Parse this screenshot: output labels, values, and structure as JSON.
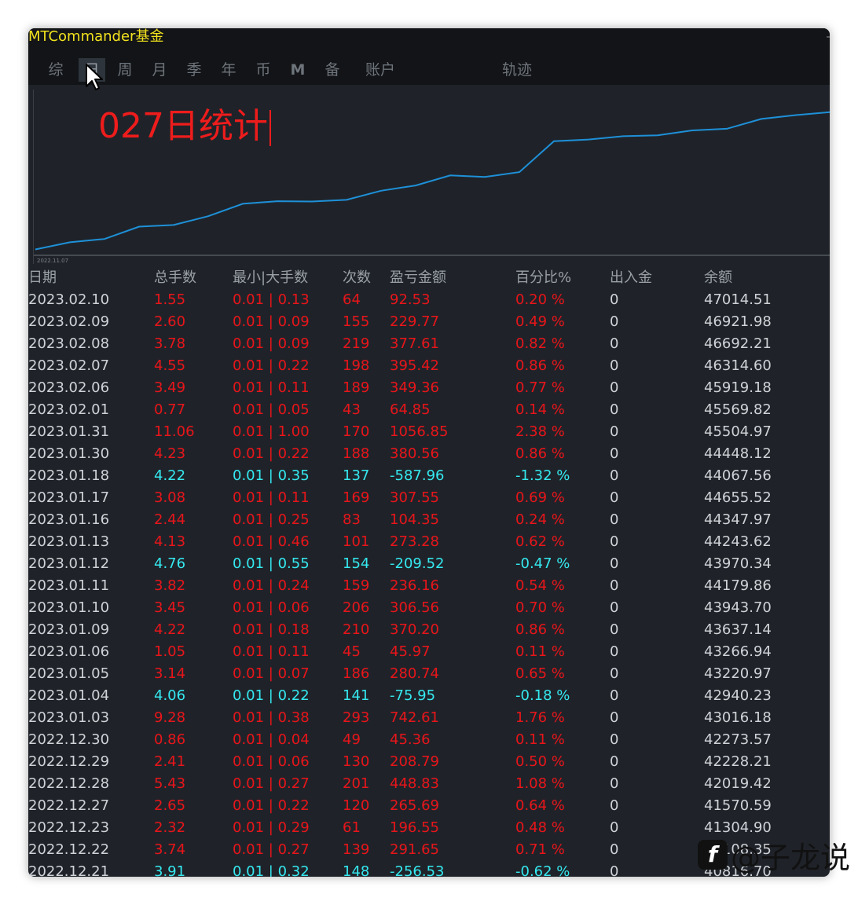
{
  "window": {
    "title": "MTCommander基金"
  },
  "tabs": [
    {
      "label": "综"
    },
    {
      "label": "日"
    },
    {
      "label": "周"
    },
    {
      "label": "月"
    },
    {
      "label": "季"
    },
    {
      "label": "年"
    },
    {
      "label": "币"
    },
    {
      "label": "M"
    },
    {
      "label": "备"
    },
    {
      "label": "账户"
    },
    {
      "label": "轨迹"
    }
  ],
  "active_tab": "日",
  "chart": {
    "title": "027日统计",
    "x_start_label": "2022.11.07",
    "line_color": "#1e90d8",
    "chart_data": {
      "type": "line",
      "title": "027日统计",
      "xlabel": "",
      "ylabel": "",
      "x": [
        "2022.11.07"
      ],
      "series": [
        {
          "values": [
            41580,
            41800,
            41900,
            42280,
            42330,
            42600,
            42980,
            43060,
            43050,
            43100,
            43380,
            43540,
            43850,
            43800,
            43950,
            44900,
            44950,
            45050,
            45080,
            45230,
            45280,
            45580,
            45700,
            45790
          ]
        }
      ]
    }
  },
  "table": {
    "headers": [
      "日期",
      "总手数",
      "最小|大手数",
      "次数",
      "盈亏金额",
      "百分比%",
      "出入金",
      "余额"
    ],
    "rows": [
      {
        "date": "2023.02.10",
        "lots": "1.55",
        "minmax": "0.01 | 0.13",
        "count": "64",
        "pnl": "92.53",
        "pct": "0.20 %",
        "inout": "0",
        "balance": "47014.51",
        "sign": "pos"
      },
      {
        "date": "2023.02.09",
        "lots": "2.60",
        "minmax": "0.01 | 0.09",
        "count": "155",
        "pnl": "229.77",
        "pct": "0.49 %",
        "inout": "0",
        "balance": "46921.98",
        "sign": "pos"
      },
      {
        "date": "2023.02.08",
        "lots": "3.78",
        "minmax": "0.01 | 0.09",
        "count": "219",
        "pnl": "377.61",
        "pct": "0.82 %",
        "inout": "0",
        "balance": "46692.21",
        "sign": "pos"
      },
      {
        "date": "2023.02.07",
        "lots": "4.55",
        "minmax": "0.01 | 0.22",
        "count": "198",
        "pnl": "395.42",
        "pct": "0.86 %",
        "inout": "0",
        "balance": "46314.60",
        "sign": "pos"
      },
      {
        "date": "2023.02.06",
        "lots": "3.49",
        "minmax": "0.01 | 0.11",
        "count": "189",
        "pnl": "349.36",
        "pct": "0.77 %",
        "inout": "0",
        "balance": "45919.18",
        "sign": "pos"
      },
      {
        "date": "2023.02.01",
        "lots": "0.77",
        "minmax": "0.01 | 0.05",
        "count": "43",
        "pnl": "64.85",
        "pct": "0.14 %",
        "inout": "0",
        "balance": "45569.82",
        "sign": "pos"
      },
      {
        "date": "2023.01.31",
        "lots": "11.06",
        "minmax": "0.01 | 1.00",
        "count": "170",
        "pnl": "1056.85",
        "pct": "2.38 %",
        "inout": "0",
        "balance": "45504.97",
        "sign": "pos"
      },
      {
        "date": "2023.01.30",
        "lots": "4.23",
        "minmax": "0.01 | 0.22",
        "count": "188",
        "pnl": "380.56",
        "pct": "0.86 %",
        "inout": "0",
        "balance": "44448.12",
        "sign": "pos"
      },
      {
        "date": "2023.01.18",
        "lots": "4.22",
        "minmax": "0.01 | 0.35",
        "count": "137",
        "pnl": "-587.96",
        "pct": "-1.32 %",
        "inout": "0",
        "balance": "44067.56",
        "sign": "neg"
      },
      {
        "date": "2023.01.17",
        "lots": "3.08",
        "minmax": "0.01 | 0.11",
        "count": "169",
        "pnl": "307.55",
        "pct": "0.69 %",
        "inout": "0",
        "balance": "44655.52",
        "sign": "pos"
      },
      {
        "date": "2023.01.16",
        "lots": "2.44",
        "minmax": "0.01 | 0.25",
        "count": "83",
        "pnl": "104.35",
        "pct": "0.24 %",
        "inout": "0",
        "balance": "44347.97",
        "sign": "pos"
      },
      {
        "date": "2023.01.13",
        "lots": "4.13",
        "minmax": "0.01 | 0.46",
        "count": "101",
        "pnl": "273.28",
        "pct": "0.62 %",
        "inout": "0",
        "balance": "44243.62",
        "sign": "pos"
      },
      {
        "date": "2023.01.12",
        "lots": "4.76",
        "minmax": "0.01 | 0.55",
        "count": "154",
        "pnl": "-209.52",
        "pct": "-0.47 %",
        "inout": "0",
        "balance": "43970.34",
        "sign": "neg"
      },
      {
        "date": "2023.01.11",
        "lots": "3.82",
        "minmax": "0.01 | 0.24",
        "count": "159",
        "pnl": "236.16",
        "pct": "0.54 %",
        "inout": "0",
        "balance": "44179.86",
        "sign": "pos"
      },
      {
        "date": "2023.01.10",
        "lots": "3.45",
        "minmax": "0.01 | 0.06",
        "count": "206",
        "pnl": "306.56",
        "pct": "0.70 %",
        "inout": "0",
        "balance": "43943.70",
        "sign": "pos"
      },
      {
        "date": "2023.01.09",
        "lots": "4.22",
        "minmax": "0.01 | 0.18",
        "count": "210",
        "pnl": "370.20",
        "pct": "0.86 %",
        "inout": "0",
        "balance": "43637.14",
        "sign": "pos"
      },
      {
        "date": "2023.01.06",
        "lots": "1.05",
        "minmax": "0.01 | 0.11",
        "count": "45",
        "pnl": "45.97",
        "pct": "0.11 %",
        "inout": "0",
        "balance": "43266.94",
        "sign": "pos"
      },
      {
        "date": "2023.01.05",
        "lots": "3.14",
        "minmax": "0.01 | 0.07",
        "count": "186",
        "pnl": "280.74",
        "pct": "0.65 %",
        "inout": "0",
        "balance": "43220.97",
        "sign": "pos"
      },
      {
        "date": "2023.01.04",
        "lots": "4.06",
        "minmax": "0.01 | 0.22",
        "count": "141",
        "pnl": "-75.95",
        "pct": "-0.18 %",
        "inout": "0",
        "balance": "42940.23",
        "sign": "neg"
      },
      {
        "date": "2023.01.03",
        "lots": "9.28",
        "minmax": "0.01 | 0.38",
        "count": "293",
        "pnl": "742.61",
        "pct": "1.76 %",
        "inout": "0",
        "balance": "43016.18",
        "sign": "pos"
      },
      {
        "date": "2022.12.30",
        "lots": "0.86",
        "minmax": "0.01 | 0.04",
        "count": "49",
        "pnl": "45.36",
        "pct": "0.11 %",
        "inout": "0",
        "balance": "42273.57",
        "sign": "pos"
      },
      {
        "date": "2022.12.29",
        "lots": "2.41",
        "minmax": "0.01 | 0.06",
        "count": "130",
        "pnl": "208.79",
        "pct": "0.50 %",
        "inout": "0",
        "balance": "42228.21",
        "sign": "pos"
      },
      {
        "date": "2022.12.28",
        "lots": "5.43",
        "minmax": "0.01 | 0.27",
        "count": "201",
        "pnl": "448.83",
        "pct": "1.08 %",
        "inout": "0",
        "balance": "42019.42",
        "sign": "pos"
      },
      {
        "date": "2022.12.27",
        "lots": "2.65",
        "minmax": "0.01 | 0.22",
        "count": "120",
        "pnl": "265.69",
        "pct": "0.64 %",
        "inout": "0",
        "balance": "41570.59",
        "sign": "pos"
      },
      {
        "date": "2022.12.23",
        "lots": "2.32",
        "minmax": "0.01 | 0.29",
        "count": "61",
        "pnl": "196.55",
        "pct": "0.48 %",
        "inout": "0",
        "balance": "41304.90",
        "sign": "pos"
      },
      {
        "date": "2022.12.22",
        "lots": "3.74",
        "minmax": "0.01 | 0.27",
        "count": "139",
        "pnl": "291.65",
        "pct": "0.71 %",
        "inout": "0",
        "balance": "41108.35",
        "sign": "pos"
      },
      {
        "date": "2022.12.21",
        "lots": "3.91",
        "minmax": "0.01 | 0.32",
        "count": "148",
        "pnl": "-256.53",
        "pct": "-0.62 %",
        "inout": "0",
        "balance": "40816.70",
        "sign": "neg"
      }
    ]
  },
  "watermark": {
    "text": "@子龙说"
  }
}
